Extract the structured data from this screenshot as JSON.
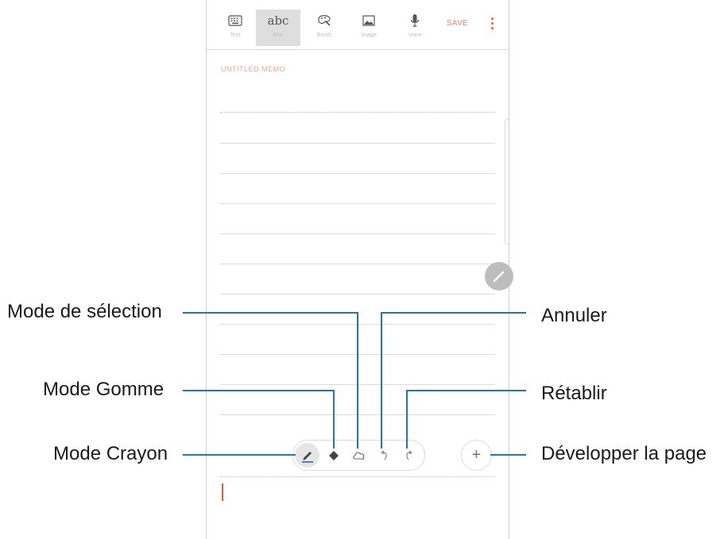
{
  "toolbar": {
    "items": [
      {
        "label": "Text",
        "icon": "keyboard-icon"
      },
      {
        "label": "Pen",
        "icon": "handwriting-icon",
        "glyph": "abc",
        "active": true
      },
      {
        "label": "Brush",
        "icon": "brush-icon"
      },
      {
        "label": "Image",
        "icon": "image-icon"
      },
      {
        "label": "Voice",
        "icon": "microphone-icon"
      }
    ],
    "save_label": "SAVE"
  },
  "note": {
    "title_placeholder": "UNTITLED MEMO"
  },
  "pen_toolbar": {
    "tools": [
      "pen-mode-icon",
      "eraser-icon",
      "lasso-selection-icon",
      "undo-icon",
      "redo-icon"
    ],
    "expand_label": "+"
  },
  "callouts": {
    "selection": "Mode de sélection",
    "eraser": "Mode Gomme",
    "pen": "Mode Crayon",
    "undo": "Annuler",
    "redo": "Rétablir",
    "expand": "Développer la page"
  },
  "colors": {
    "accent": "#e0603c",
    "leader_line": "#1f78b4",
    "active_tab_bg": "#dedede"
  }
}
